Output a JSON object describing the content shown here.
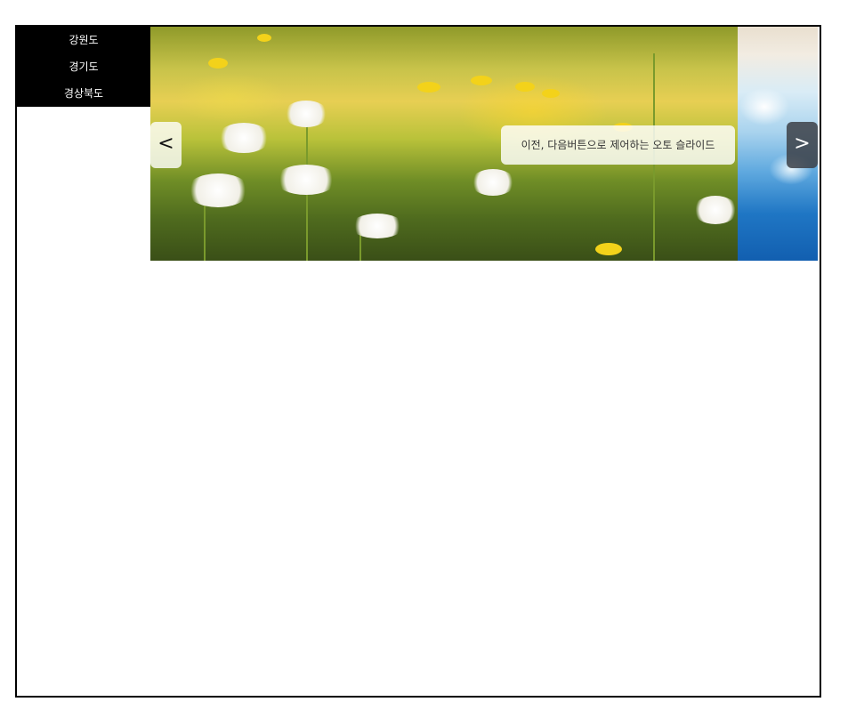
{
  "menu": {
    "items": [
      {
        "label": "강원도"
      },
      {
        "label": "경기도"
      },
      {
        "label": "경상북도"
      }
    ]
  },
  "slider": {
    "caption": "이전, 다음버튼으로 제어하는 오토 슬라이드",
    "prev_label": "<",
    "next_label": ">",
    "slides": [
      {
        "image": "dandelion-meadow-photo"
      },
      {
        "image": "ocean-beach-aerial-photo"
      }
    ]
  },
  "colors": {
    "menu_background": "#000000",
    "menu_text": "#ffffff",
    "frame_border": "#000000"
  }
}
